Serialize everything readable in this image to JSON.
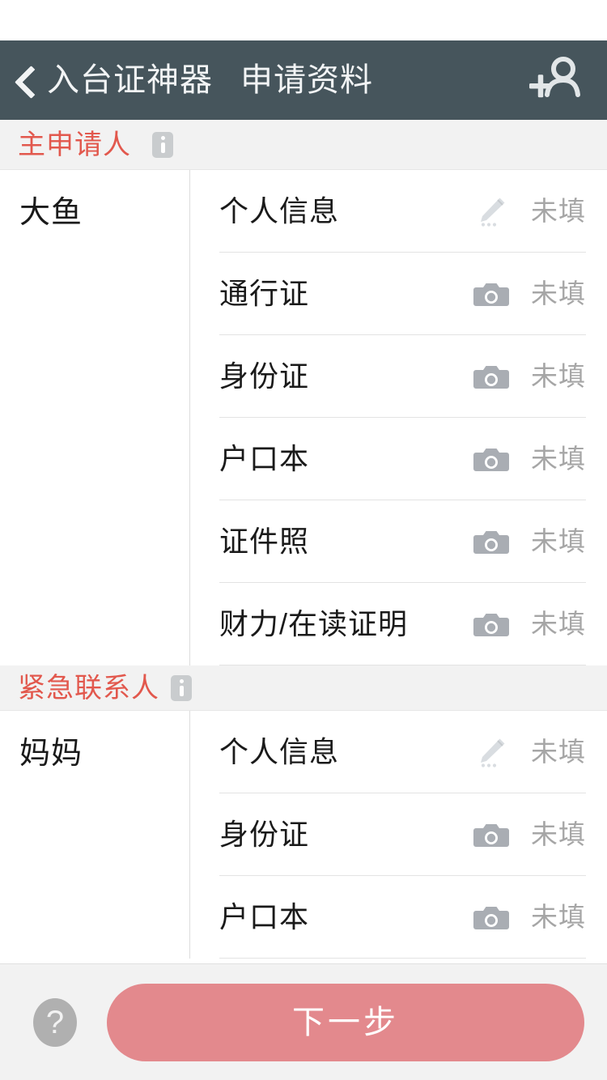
{
  "nav": {
    "back_icon": "back-chevron-icon",
    "app_name": "入台证神器",
    "title": "申请资料",
    "add_person_icon": "add-person-icon"
  },
  "colors": {
    "nav_background": "#46555c",
    "section_title": "#e2584d",
    "primary_button": "#e3898d",
    "section_band": "#f2f2f2",
    "status_text": "#a6a6a6",
    "icon_grey": "#a9adb3",
    "divider": "#e3e3e3"
  },
  "status_labels": {
    "unfilled": "未填"
  },
  "sections": [
    {
      "title": "主申请人",
      "info_icon": "info-icon",
      "person": "大鱼",
      "documents": [
        {
          "label": "个人信息",
          "icon": "pencil-icon",
          "status": "未填"
        },
        {
          "label": "通行证",
          "icon": "camera-icon",
          "status": "未填"
        },
        {
          "label": "身份证",
          "icon": "camera-icon",
          "status": "未填"
        },
        {
          "label": "户口本",
          "icon": "camera-icon",
          "status": "未填"
        },
        {
          "label": "证件照",
          "icon": "camera-icon",
          "status": "未填"
        },
        {
          "label": "财力/在读证明",
          "icon": "camera-icon",
          "status": "未填"
        }
      ]
    },
    {
      "title": "紧急联系人",
      "info_icon": "info-icon",
      "person": "妈妈",
      "documents": [
        {
          "label": "个人信息",
          "icon": "pencil-icon",
          "status": "未填"
        },
        {
          "label": "身份证",
          "icon": "camera-icon",
          "status": "未填"
        },
        {
          "label": "户口本",
          "icon": "camera-icon",
          "status": "未填"
        }
      ]
    }
  ],
  "bottom": {
    "help_icon": "help-question-icon",
    "next_label": "下一步"
  }
}
